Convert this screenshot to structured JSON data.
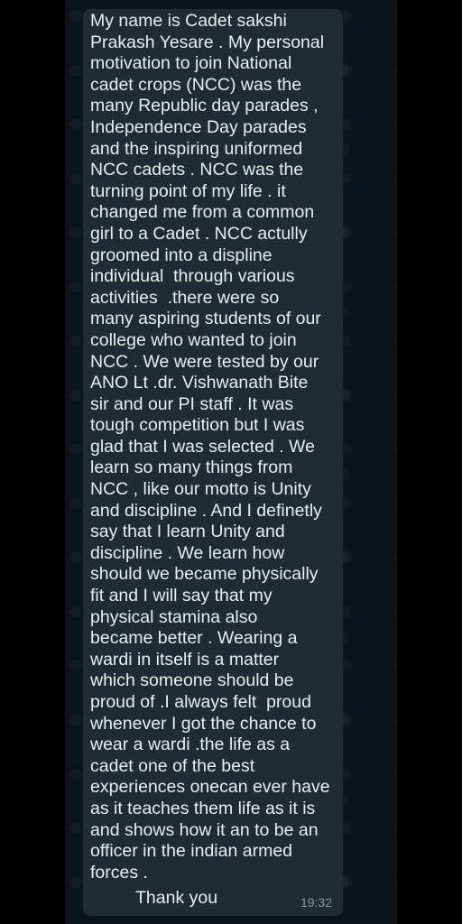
{
  "message": {
    "lines": [
      "My name is Cadet sakshi",
      "Prakash Yesare . My personal",
      "motivation to join National",
      "cadet crops (NCC) was the",
      "many Republic day parades ,",
      "Independence Day parades",
      "and the inspiring uniformed",
      "NCC cadets . NCC was the",
      "turning point of my life . it",
      "changed me from a common",
      "girl to a Cadet . NCC actully",
      "groomed into a displine",
      "individual  through various",
      "activities  .there were so",
      "many aspiring students of our",
      "college who wanted to join",
      "NCC . We were tested by our",
      "ANO Lt .dr. Vishwanath Bite",
      "sir and our PI staff . It was",
      "tough competition but I was",
      "glad that I was selected . We",
      "learn so many things from",
      "NCC , like our motto is Unity",
      "and discipline . And I definetly",
      "say that I learn Unity and",
      "discipline . We learn how",
      "should we became physically",
      "fit and I will say that my",
      "physical stamina also",
      "became better . Wearing a",
      "wardi in itself is a matter",
      "which someone should be",
      "proud of .I always felt  proud",
      "whenever I got the chance to",
      "wear a wardi .the life as a",
      "cadet one of the best",
      "experiences onecan ever have",
      "as it teaches them life as it is",
      "and shows how it an to be an",
      "officer in the indian armed",
      "forces ."
    ],
    "signoff": "Thank you",
    "time": "19:32"
  }
}
